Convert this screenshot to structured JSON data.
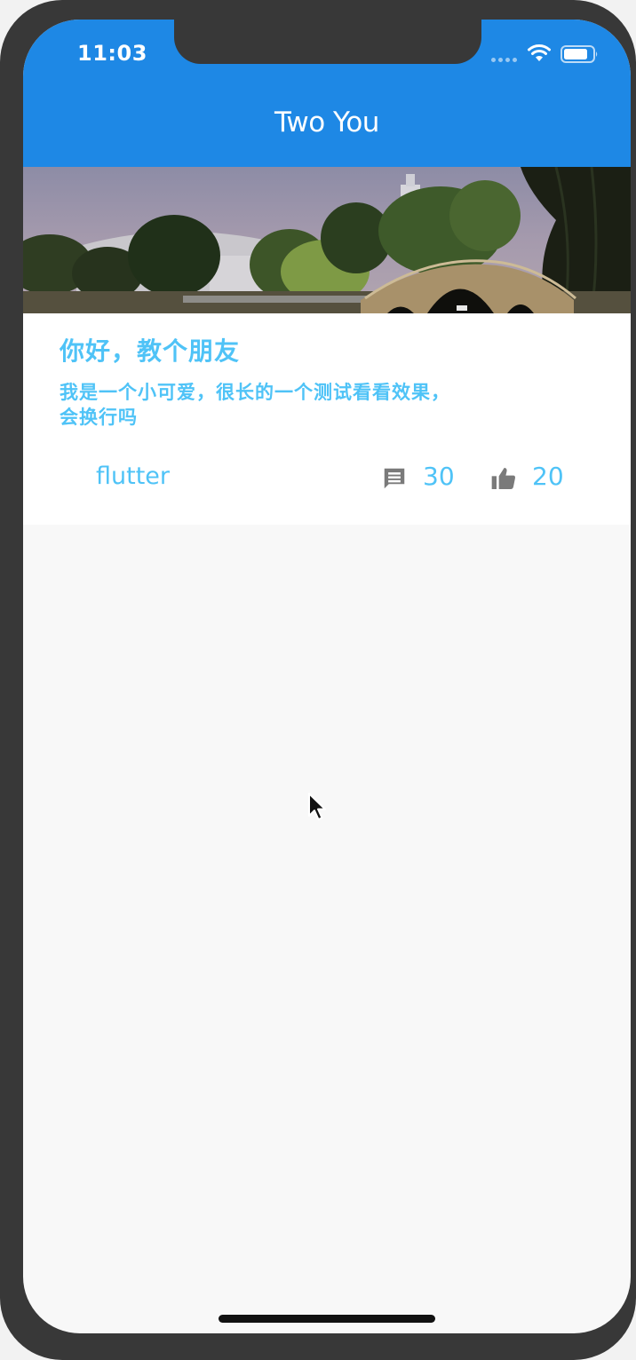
{
  "status_bar": {
    "time": "11:03",
    "signal_icon": "cellular-dots-icon",
    "wifi_icon": "wifi-icon",
    "battery_icon": "battery-icon"
  },
  "app_bar": {
    "title": "Two You",
    "background_color": "#1e88e5"
  },
  "feed": {
    "cards": [
      {
        "image_icon": "landscape-banner-image",
        "title": "你好，教个朋友",
        "description": "我是一个小可爱，很长的一个测试看看效果，会换行吗",
        "tag": "flutter",
        "comment_icon": "comment-icon",
        "comment_count": "30",
        "like_icon": "thumb-up-icon",
        "like_count": "20",
        "accent_color": "#4fc3f7"
      }
    ]
  },
  "colors": {
    "screen_background": "#f8f8f8",
    "device_frame": "#383838",
    "icon_gray": "#7a7a7a"
  }
}
